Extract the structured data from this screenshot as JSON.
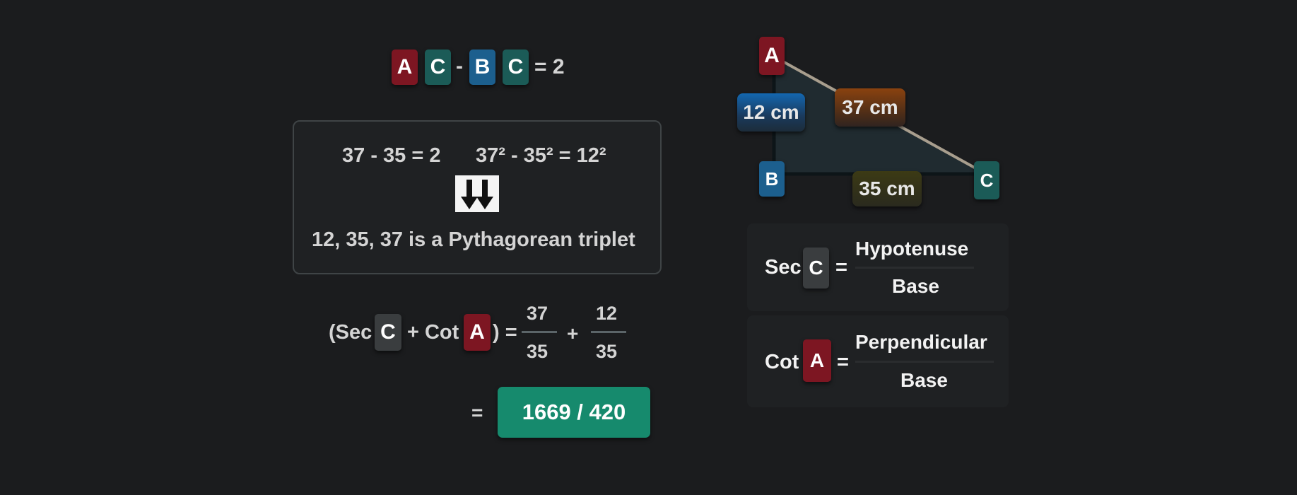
{
  "equation_top": {
    "tile_a": "A",
    "tile_c1": "C",
    "minus": "-",
    "tile_b": "B",
    "tile_c2": "C",
    "equals_value": "= 2"
  },
  "triplet_box": {
    "diff_eq": "37 - 35 = 2",
    "square_eq": "37² - 35² = 12²",
    "arrow_icon": "double-down-arrow",
    "conclusion": "12, 35, 37 is a Pythagorean triplet"
  },
  "sum_expression": {
    "open": "(Sec",
    "tile_c": "C",
    "plus_cot": "+ Cot",
    "tile_a": "A",
    "close_eq": ") =",
    "frac1_num": "37",
    "frac1_den": "35",
    "plus": "+",
    "frac2_num": "12",
    "frac2_den": "35"
  },
  "result": {
    "equals": "=",
    "value": "1669 / 420"
  },
  "triangle": {
    "vertex_a": "A",
    "vertex_b": "B",
    "vertex_c": "C",
    "side_ab": "12 cm",
    "side_ac": "37 cm",
    "side_bc": "35 cm",
    "colors": {
      "side_ab_label": "#1a5e9e",
      "side_ac_label": "#7a3b12",
      "side_bc_label": "#3a3a1c",
      "hypotenuse_line": "#a89e8e"
    }
  },
  "sec_def": {
    "label": "Sec",
    "tile_c": "C",
    "eq": "=",
    "numerator": "Hypotenuse",
    "denominator": "Base"
  },
  "cot_def": {
    "label": "Cot",
    "tile_a": "A",
    "eq": "=",
    "numerator": "Perpendicular",
    "denominator": "Base"
  }
}
